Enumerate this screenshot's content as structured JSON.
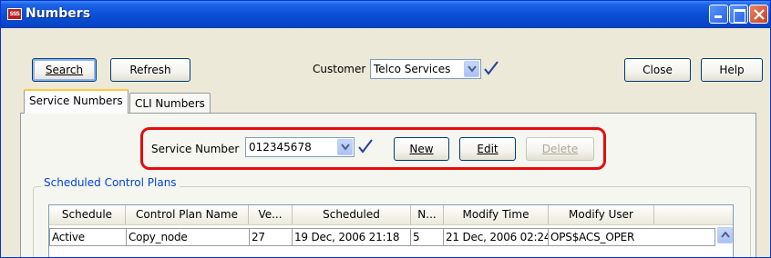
{
  "window": {
    "title": "Numbers",
    "app_icon_text": "SSS",
    "icons": [
      "minimize-icon",
      "maximize-icon",
      "close-icon"
    ]
  },
  "toolbar": {
    "search_label": "Search",
    "refresh_label": "Refresh",
    "customer_label": "Customer",
    "customer_value": "Telco Services",
    "close_label": "Close",
    "help_label": "Help"
  },
  "tabs": [
    {
      "label": "Service Numbers",
      "active": true
    },
    {
      "label": "CLI Numbers",
      "active": false
    }
  ],
  "service": {
    "label": "Service Number",
    "value": "012345678",
    "new_label": "New",
    "edit_label": "Edit",
    "delete_label": "Delete"
  },
  "scheduled": {
    "title": "Scheduled Control Plans",
    "columns": [
      "Schedule",
      "Control Plan Name",
      "Ve...",
      "Scheduled",
      "N...",
      "Modify Time",
      "Modify User"
    ],
    "rows": [
      [
        "Active",
        "Copy_node",
        "27",
        "19 Dec, 2006 21:18",
        "5",
        "21 Dec, 2006 02:24",
        "OPS$ACS_OPER"
      ]
    ]
  },
  "colors": {
    "titlebar": "#0a4fd6",
    "highlight": "#e30d0d",
    "group_title": "#0046d5",
    "check": "#1f3fa0"
  }
}
